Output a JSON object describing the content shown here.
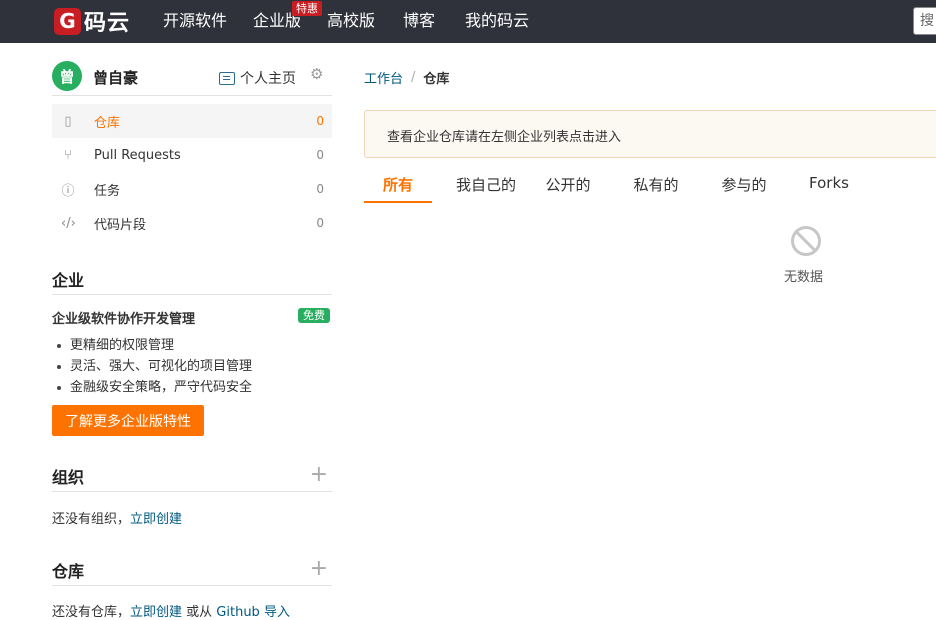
{
  "nav": {
    "logo_glyph": "G",
    "logo_text": "码云",
    "items": [
      "开源软件",
      "企业版",
      "高校版",
      "博客",
      "我的码云"
    ],
    "enterprise_badge": "特惠",
    "search_placeholder": "搜"
  },
  "user": {
    "avatar_char": "曾",
    "name": "曾自豪",
    "homepage_label": "个人主页"
  },
  "menu": [
    {
      "label": "仓库",
      "count": "0",
      "icon": "repo-icon"
    },
    {
      "label": "Pull Requests",
      "count": "0",
      "icon": "pull-request-icon"
    },
    {
      "label": "任务",
      "count": "0",
      "icon": "issue-icon"
    },
    {
      "label": "代码片段",
      "count": "0",
      "icon": "code-icon"
    }
  ],
  "enterprise": {
    "title": "企业",
    "subtitle": "企业级软件协作开发管理",
    "badge": "免费",
    "features": [
      "更精细的权限管理",
      "灵活、强大、可视化的项目管理",
      "金融级安全策略，严守代码安全"
    ],
    "button_label": "了解更多企业版特性"
  },
  "organizations": {
    "title": "组织",
    "empty_text": "还没有组织，",
    "create_link": "立即创建"
  },
  "repositories": {
    "title": "仓库",
    "empty_text": "还没有仓库，",
    "create_link": "立即创建",
    "or_text": " 或从 ",
    "import_link": "Github 导入"
  },
  "breadcrumb": {
    "root": "工作台",
    "separator": "/",
    "current": "仓库"
  },
  "notice": "查看企业仓库请在左侧企业列表点击进入",
  "tabs": [
    "所有",
    "我自己的",
    "公开的",
    "私有的",
    "参与的",
    "Forks"
  ],
  "empty_state": "无数据"
}
